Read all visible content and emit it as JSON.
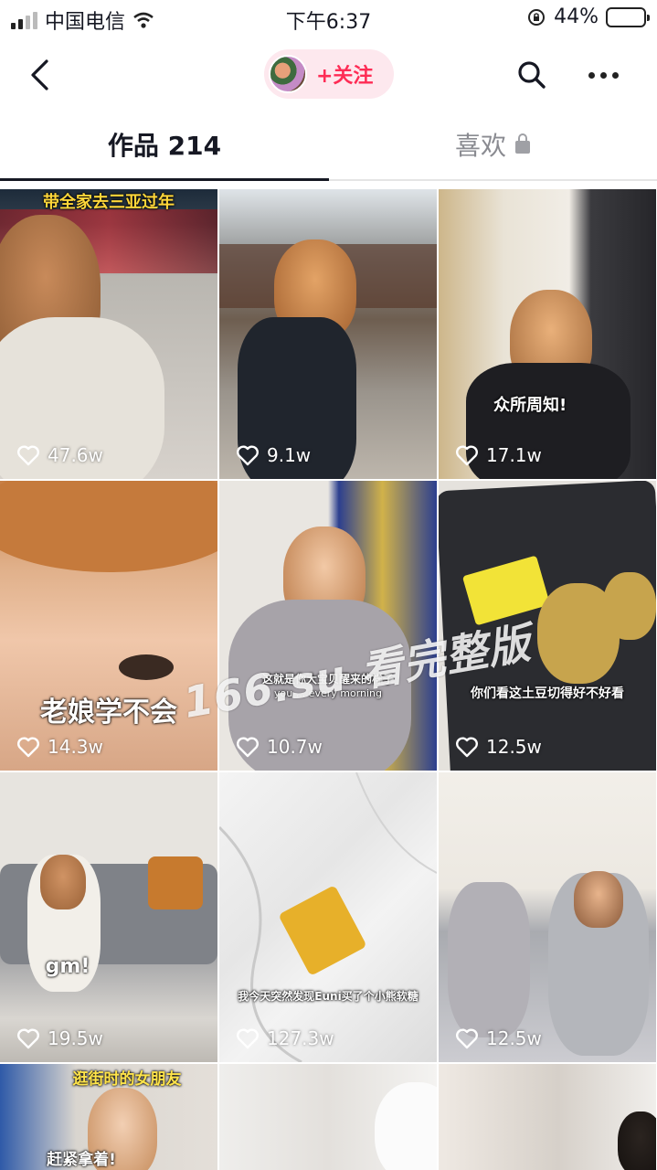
{
  "status_bar": {
    "carrier": "中国电信",
    "time": "下午6:37",
    "battery_percent": "44%",
    "battery_level": 0.44
  },
  "header": {
    "follow_label": "+关注"
  },
  "tabs": {
    "works_label": "作品 214",
    "likes_label": "喜欢"
  },
  "videos": [
    {
      "caption": "带全家去三亚过年",
      "likes": "47.6w"
    },
    {
      "caption": "",
      "likes": "9.1w"
    },
    {
      "caption": "众所周知!",
      "likes": "17.1w"
    },
    {
      "caption": "老娘学不会",
      "likes": "14.3w"
    },
    {
      "caption": "这就是你大宝贝醒来的样子",
      "subcaption": "you ... every morning",
      "likes": "10.7w"
    },
    {
      "caption": "你们看这土豆切得好不好看",
      "likes": "12.5w"
    },
    {
      "caption": "gm!",
      "likes": "19.5w"
    },
    {
      "caption": "我今天突然发现Euni买了个小熊软糖",
      "likes": "127.3w"
    },
    {
      "caption": "",
      "likes": "12.5w"
    },
    {
      "caption": "逛街时的女朋友",
      "subcaption": "赶紧拿着!"
    },
    {
      "caption": ""
    },
    {
      "caption": ""
    }
  ],
  "watermark": "166.su 看完整版",
  "colors": {
    "accent": "#fe2c55",
    "follow_bg": "#fde8ee",
    "text": "#161823",
    "muted": "#8a8b91"
  },
  "icons": [
    "back-arrow-icon",
    "search-icon",
    "more-icon",
    "lock-icon",
    "heart-icon",
    "wifi-icon",
    "signal-icon",
    "battery-icon",
    "orientation-lock-icon"
  ]
}
